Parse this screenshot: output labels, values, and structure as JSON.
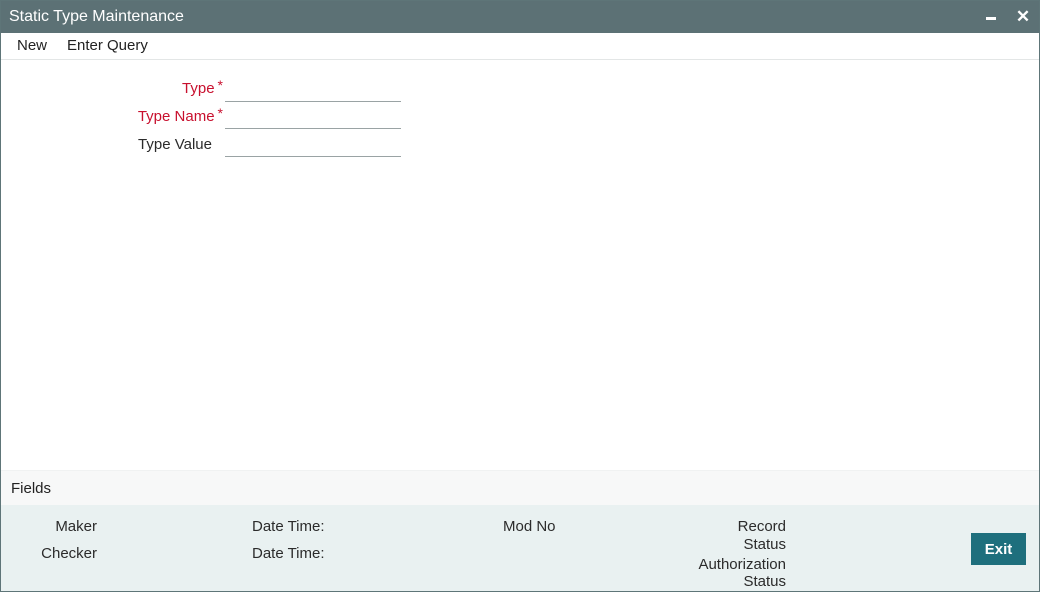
{
  "window": {
    "title": "Static Type Maintenance",
    "minimize_glyph": "",
    "close_glyph": "✕"
  },
  "menu": {
    "new_label": "New",
    "enter_query_label": "Enter Query"
  },
  "form": {
    "type": {
      "label": "Type",
      "required_mark": "*",
      "value": ""
    },
    "type_name": {
      "label": "Type Name",
      "required_mark": "*",
      "value": ""
    },
    "type_value": {
      "label": "Type Value",
      "value": ""
    }
  },
  "fields_tab": {
    "label": "Fields"
  },
  "audit": {
    "maker": "Maker",
    "checker": "Checker",
    "maker_datetime": "Date Time:",
    "checker_datetime": "Date Time:",
    "mod_no": "Mod No",
    "record_status_line1": "Record",
    "record_status_line2": "Status",
    "auth_status_line1": "Authorization",
    "auth_status_line2": "Status"
  },
  "buttons": {
    "exit": "Exit"
  },
  "colors": {
    "titlebar": "#5c7175",
    "required": "#c8102e",
    "exit_button": "#1e6f7d",
    "audit_bg": "#e9f1f1"
  },
  "icons": {
    "minimize": "minimize-icon",
    "close": "close-icon"
  }
}
